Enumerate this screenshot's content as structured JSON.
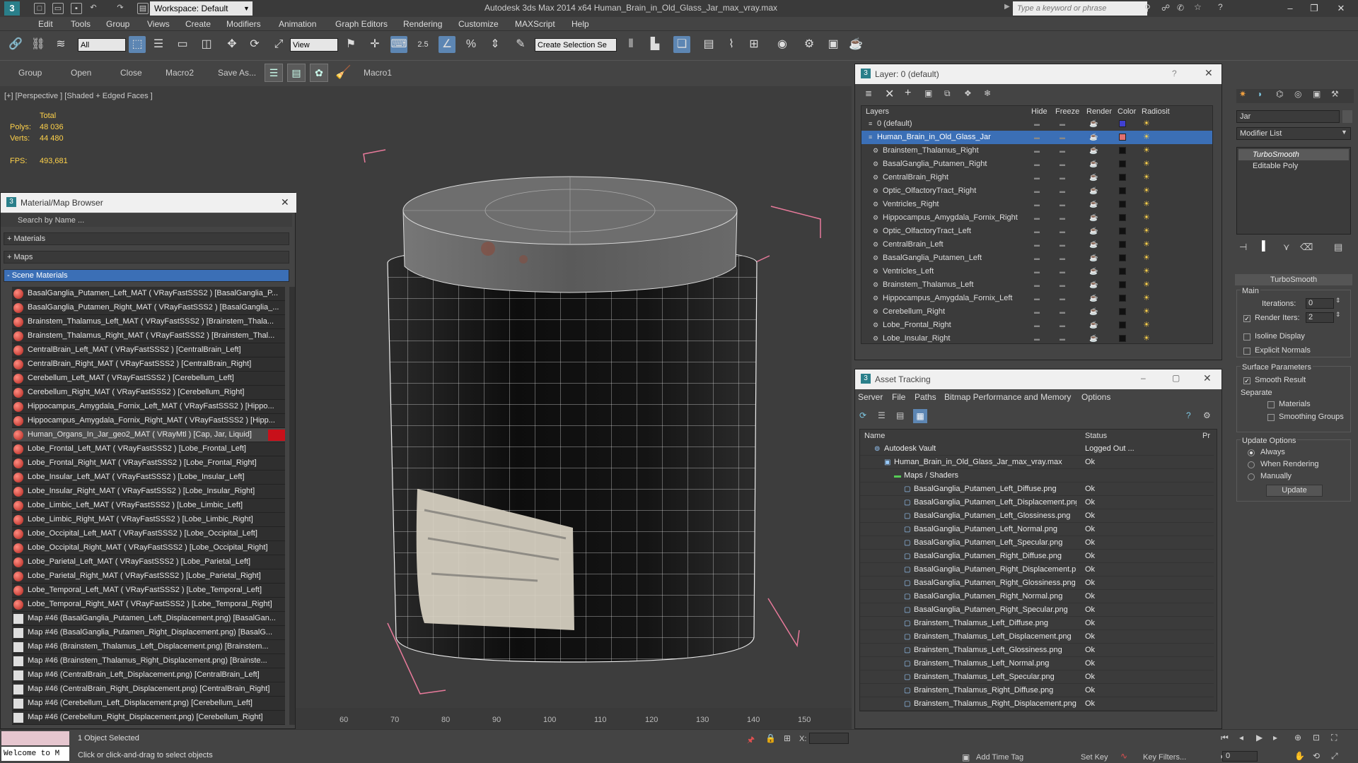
{
  "titlebar": {
    "workspace": "Workspace: Default",
    "app_title": "Autodesk 3ds Max  2014 x64      Human_Brain_in_Old_Glass_Jar_max_vray.max",
    "search_placeholder": "Type a keyword or phrase"
  },
  "menu": [
    "Edit",
    "Tools",
    "Group",
    "Views",
    "Create",
    "Modifiers",
    "Animation",
    "Graph Editors",
    "Rendering",
    "Customize",
    "MAXScript",
    "Help"
  ],
  "toolbar": {
    "filter_value": "All",
    "view_value": "View",
    "selection_set": "Create Selection Se",
    "snap_value": "2.5"
  },
  "toolbar2": {
    "buttons": [
      "Group",
      "Open",
      "Close",
      "Macro2",
      "Save As...",
      "Macro1"
    ]
  },
  "viewport": {
    "label": "[+] [Perspective ] [Shaded + Edged Faces ]",
    "total_label": "Total",
    "polys_label": "Polys:",
    "polys_value": "48 036",
    "verts_label": "Verts:",
    "verts_value": "44 480",
    "fps_label": "FPS:",
    "fps_value": "493,681"
  },
  "timeline": {
    "ticks": [
      "60",
      "70",
      "80",
      "90",
      "100",
      "110",
      "120",
      "130",
      "140",
      "150"
    ]
  },
  "material_browser": {
    "title": "Material/Map Browser",
    "search_placeholder": "Search by Name ...",
    "categories": [
      "+ Materials",
      "+ Maps",
      "- Scene Materials"
    ],
    "items": [
      {
        "label": "BasalGanglia_Putamen_Left_MAT ( VRayFastSSS2 ) [BasalGanglia_P...",
        "type": "mat"
      },
      {
        "label": "BasalGanglia_Putamen_Right_MAT ( VRayFastSSS2 ) [BasalGanglia_...",
        "type": "mat"
      },
      {
        "label": "Brainstem_Thalamus_Left_MAT ( VRayFastSSS2 ) [Brainstem_Thala...",
        "type": "mat"
      },
      {
        "label": "Brainstem_Thalamus_Right_MAT ( VRayFastSSS2 ) [Brainstem_Thal...",
        "type": "mat"
      },
      {
        "label": "CentralBrain_Left_MAT ( VRayFastSSS2 ) [CentralBrain_Left]",
        "type": "mat"
      },
      {
        "label": "CentralBrain_Right_MAT ( VRayFastSSS2 ) [CentralBrain_Right]",
        "type": "mat"
      },
      {
        "label": "Cerebellum_Left_MAT ( VRayFastSSS2 ) [Cerebellum_Left]",
        "type": "mat"
      },
      {
        "label": "Cerebellum_Right_MAT ( VRayFastSSS2 ) [Cerebellum_Right]",
        "type": "mat"
      },
      {
        "label": "Hippocampus_Amygdala_Fornix_Left_MAT ( VRayFastSSS2 ) [Hippo...",
        "type": "mat"
      },
      {
        "label": "Hippocampus_Amygdala_Fornix_Right_MAT ( VRayFastSSS2 ) [Hipp...",
        "type": "mat"
      },
      {
        "label": "Human_Organs_In_Jar_geo2_MAT ( VRayMtl ) [Cap, Jar, Liquid]",
        "type": "mat",
        "selected": true
      },
      {
        "label": "Lobe_Frontal_Left_MAT ( VRayFastSSS2 ) [Lobe_Frontal_Left]",
        "type": "mat"
      },
      {
        "label": "Lobe_Frontal_Right_MAT ( VRayFastSSS2 ) [Lobe_Frontal_Right]",
        "type": "mat"
      },
      {
        "label": "Lobe_Insular_Left_MAT ( VRayFastSSS2 ) [Lobe_Insular_Left]",
        "type": "mat"
      },
      {
        "label": "Lobe_Insular_Right_MAT ( VRayFastSSS2 ) [Lobe_Insular_Right]",
        "type": "mat"
      },
      {
        "label": "Lobe_Limbic_Left_MAT ( VRayFastSSS2 ) [Lobe_Limbic_Left]",
        "type": "mat"
      },
      {
        "label": "Lobe_Limbic_Right_MAT ( VRayFastSSS2 ) [Lobe_Limbic_Right]",
        "type": "mat"
      },
      {
        "label": "Lobe_Occipital_Left_MAT ( VRayFastSSS2 ) [Lobe_Occipital_Left]",
        "type": "mat"
      },
      {
        "label": "Lobe_Occipital_Right_MAT ( VRayFastSSS2 ) [Lobe_Occipital_Right]",
        "type": "mat"
      },
      {
        "label": "Lobe_Parietal_Left_MAT ( VRayFastSSS2 ) [Lobe_Parietal_Left]",
        "type": "mat"
      },
      {
        "label": "Lobe_Parietal_Right_MAT ( VRayFastSSS2 ) [Lobe_Parietal_Right]",
        "type": "mat"
      },
      {
        "label": "Lobe_Temporal_Left_MAT ( VRayFastSSS2 ) [Lobe_Temporal_Left]",
        "type": "mat"
      },
      {
        "label": "Lobe_Temporal_Right_MAT ( VRayFastSSS2 ) [Lobe_Temporal_Right]",
        "type": "mat"
      },
      {
        "label": "Map #46 (BasalGanglia_Putamen_Left_Displacement.png) [BasalGan...",
        "type": "map"
      },
      {
        "label": "Map #46 (BasalGanglia_Putamen_Right_Displacement.png) [BasalG...",
        "type": "map"
      },
      {
        "label": "Map #46 (Brainstem_Thalamus_Left_Displacement.png) [Brainstem...",
        "type": "map"
      },
      {
        "label": "Map #46 (Brainstem_Thalamus_Right_Displacement.png) [Brainste...",
        "type": "map"
      },
      {
        "label": "Map #46 (CentralBrain_Left_Displacement.png) [CentralBrain_Left]",
        "type": "map"
      },
      {
        "label": "Map #46 (CentralBrain_Right_Displacement.png) [CentralBrain_Right]",
        "type": "map"
      },
      {
        "label": "Map #46 (Cerebellum_Left_Displacement.png) [Cerebellum_Left]",
        "type": "map"
      },
      {
        "label": "Map #46 (Cerebellum_Right_Displacement.png) [Cerebellum_Right]",
        "type": "map"
      }
    ]
  },
  "layers": {
    "title": "Layer: 0 (default)",
    "columns": [
      "Layers",
      "Hide",
      "Freeze",
      "Render",
      "Color",
      "Radiosit"
    ],
    "rows": [
      {
        "name": "0 (default)",
        "level": 0,
        "color": "#4040d0"
      },
      {
        "name": "Human_Brain_in_Old_Glass_Jar",
        "level": 0,
        "selected": true,
        "color": "#e07070"
      },
      {
        "name": "Brainstem_Thalamus_Right",
        "level": 1,
        "color": "#111"
      },
      {
        "name": "BasalGanglia_Putamen_Right",
        "level": 1,
        "color": "#111"
      },
      {
        "name": "CentralBrain_Right",
        "level": 1,
        "color": "#111"
      },
      {
        "name": "Optic_OlfactoryTract_Right",
        "level": 1,
        "color": "#111"
      },
      {
        "name": "Ventricles_Right",
        "level": 1,
        "color": "#111"
      },
      {
        "name": "Hippocampus_Amygdala_Fornix_Right",
        "level": 1,
        "color": "#111"
      },
      {
        "name": "Optic_OlfactoryTract_Left",
        "level": 1,
        "color": "#111"
      },
      {
        "name": "CentralBrain_Left",
        "level": 1,
        "color": "#111"
      },
      {
        "name": "BasalGanglia_Putamen_Left",
        "level": 1,
        "color": "#111"
      },
      {
        "name": "Ventricles_Left",
        "level": 1,
        "color": "#111"
      },
      {
        "name": "Brainstem_Thalamus_Left",
        "level": 1,
        "color": "#111"
      },
      {
        "name": "Hippocampus_Amygdala_Fornix_Left",
        "level": 1,
        "color": "#111"
      },
      {
        "name": "Cerebellum_Right",
        "level": 1,
        "color": "#111"
      },
      {
        "name": "Lobe_Frontal_Right",
        "level": 1,
        "color": "#111"
      },
      {
        "name": "Lobe_Insular_Right",
        "level": 1,
        "color": "#111"
      }
    ]
  },
  "asset_tracking": {
    "title": "Asset Tracking",
    "menu": [
      "Server",
      "File",
      "Paths",
      "Bitmap Performance and Memory",
      "Options"
    ],
    "columns": [
      "Name",
      "Status",
      "Pr"
    ],
    "rows": [
      {
        "name": "Autodesk Vault",
        "status": "Logged Out ...",
        "level": 0
      },
      {
        "name": "Human_Brain_in_Old_Glass_Jar_max_vray.max",
        "status": "Ok",
        "level": 1
      },
      {
        "name": "Maps / Shaders",
        "status": "",
        "level": 2
      },
      {
        "name": "BasalGanglia_Putamen_Left_Diffuse.png",
        "status": "Ok",
        "level": 3
      },
      {
        "name": "BasalGanglia_Putamen_Left_Displacement.png",
        "status": "Ok",
        "level": 3
      },
      {
        "name": "BasalGanglia_Putamen_Left_Glossiness.png",
        "status": "Ok",
        "level": 3
      },
      {
        "name": "BasalGanglia_Putamen_Left_Normal.png",
        "status": "Ok",
        "level": 3
      },
      {
        "name": "BasalGanglia_Putamen_Left_Specular.png",
        "status": "Ok",
        "level": 3
      },
      {
        "name": "BasalGanglia_Putamen_Right_Diffuse.png",
        "status": "Ok",
        "level": 3
      },
      {
        "name": "BasalGanglia_Putamen_Right_Displacement.png",
        "status": "Ok",
        "level": 3
      },
      {
        "name": "BasalGanglia_Putamen_Right_Glossiness.png",
        "status": "Ok",
        "level": 3
      },
      {
        "name": "BasalGanglia_Putamen_Right_Normal.png",
        "status": "Ok",
        "level": 3
      },
      {
        "name": "BasalGanglia_Putamen_Right_Specular.png",
        "status": "Ok",
        "level": 3
      },
      {
        "name": "Brainstem_Thalamus_Left_Diffuse.png",
        "status": "Ok",
        "level": 3
      },
      {
        "name": "Brainstem_Thalamus_Left_Displacement.png",
        "status": "Ok",
        "level": 3
      },
      {
        "name": "Brainstem_Thalamus_Left_Glossiness.png",
        "status": "Ok",
        "level": 3
      },
      {
        "name": "Brainstem_Thalamus_Left_Normal.png",
        "status": "Ok",
        "level": 3
      },
      {
        "name": "Brainstem_Thalamus_Left_Specular.png",
        "status": "Ok",
        "level": 3
      },
      {
        "name": "Brainstem_Thalamus_Right_Diffuse.png",
        "status": "Ok",
        "level": 3
      },
      {
        "name": "Brainstem_Thalamus_Right_Displacement.png",
        "status": "Ok",
        "level": 3
      }
    ]
  },
  "command_panel": {
    "object_name": "Jar",
    "modifier_list": "Modifier List",
    "stack": [
      "TurboSmooth",
      "Editable Poly"
    ],
    "turbosmooth_title": "TurboSmooth",
    "main_label": "Main",
    "iterations_label": "Iterations:",
    "iterations_value": "0",
    "render_iters_label": "Render Iters:",
    "render_iters_value": "2",
    "isoline_label": "Isoline Display",
    "explicit_normals_label": "Explicit Normals",
    "surface_params_label": "Surface Parameters",
    "smooth_result_label": "Smooth Result",
    "separate_label": "Separate",
    "materials_label": "Materials",
    "smoothing_groups_label": "Smoothing Groups",
    "update_options_label": "Update Options",
    "always_label": "Always",
    "when_rendering_label": "When Rendering",
    "manually_label": "Manually",
    "update_button": "Update"
  },
  "status": {
    "welcome": "Welcome to M",
    "selected": "1 Object Selected",
    "hint": "Click or click-and-drag to select objects",
    "x_label": "X:",
    "add_time_tag": "Add Time Tag",
    "set_key": "Set Key",
    "key_filters": "Key Filters...",
    "frame_value": "0"
  }
}
